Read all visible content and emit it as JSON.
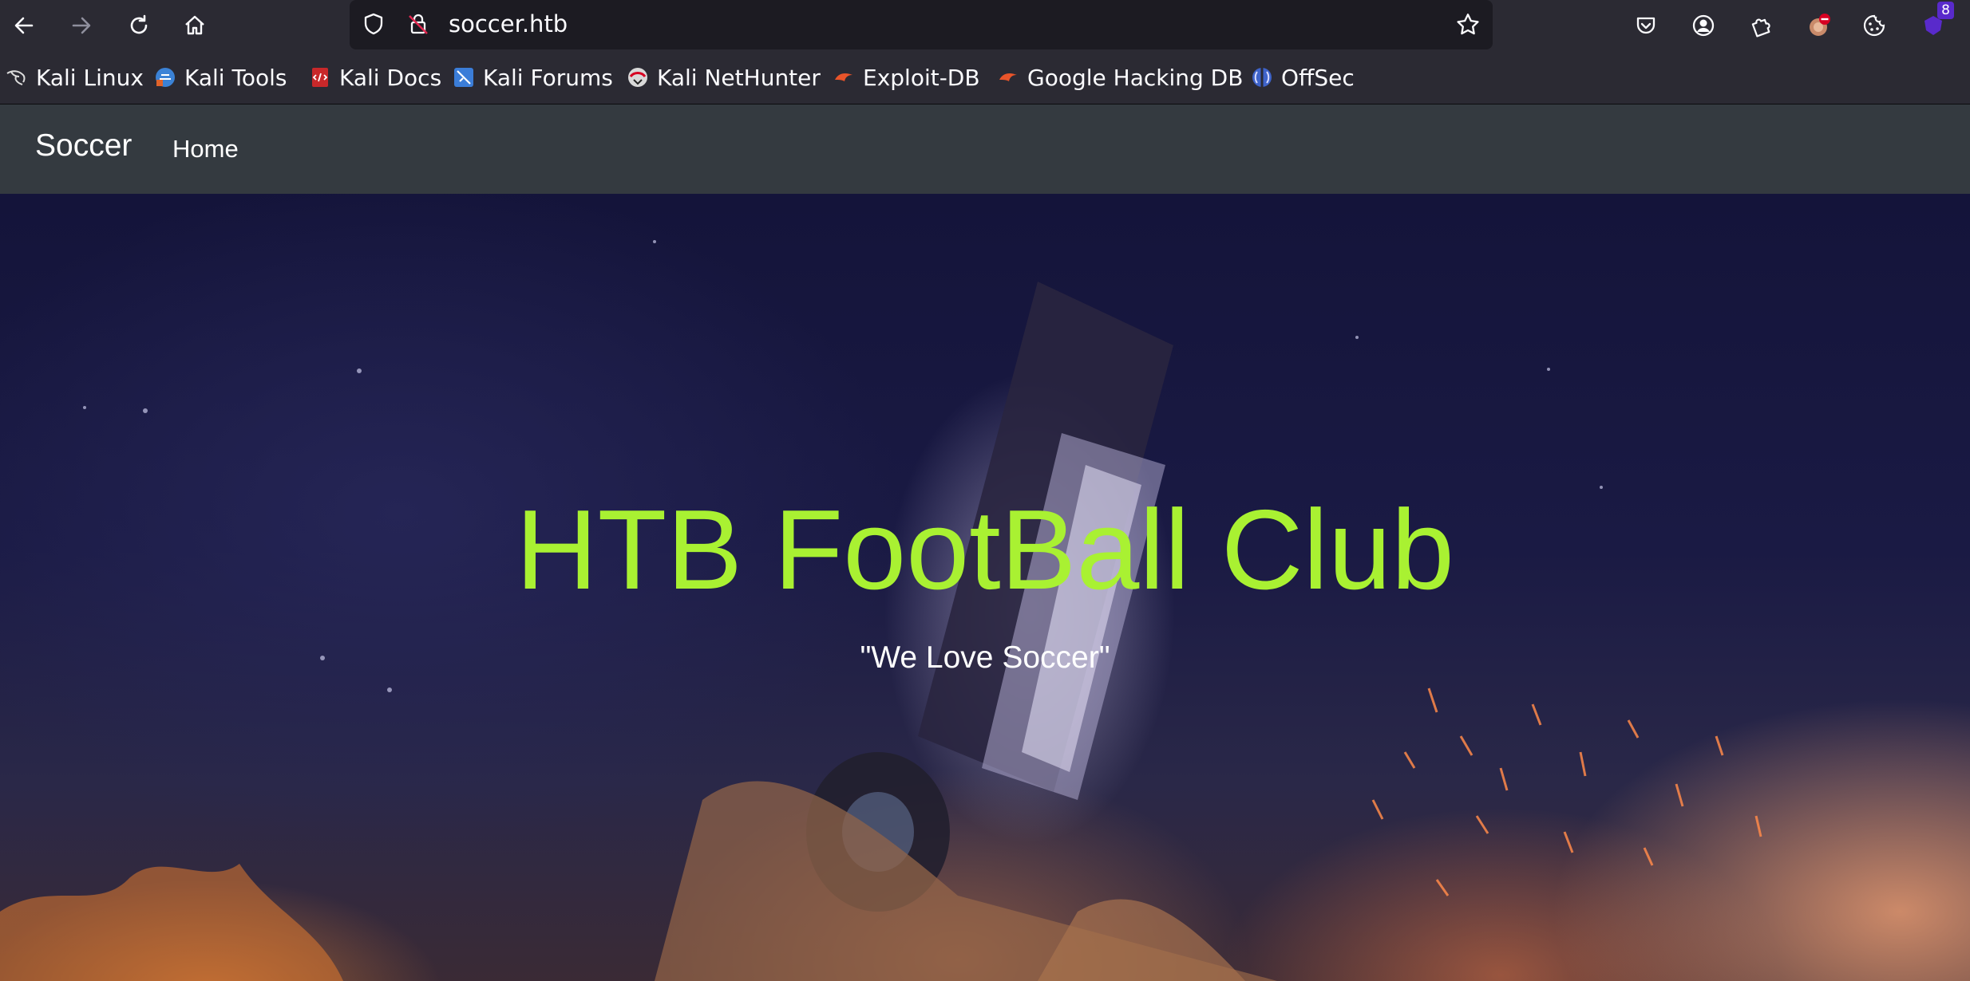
{
  "browser": {
    "url": "soccer.htb",
    "extension_badge_count": "8",
    "bookmarks": [
      {
        "label": "Kali Linux",
        "icon": "kali-dragon-icon"
      },
      {
        "label": "Kali Tools",
        "icon": "kali-tools-icon"
      },
      {
        "label": "Kali Docs",
        "icon": "kali-docs-icon"
      },
      {
        "label": "Kali Forums",
        "icon": "kali-forums-icon"
      },
      {
        "label": "Kali NetHunter",
        "icon": "kali-nethunter-icon"
      },
      {
        "label": "Exploit-DB",
        "icon": "exploit-db-icon"
      },
      {
        "label": "Google Hacking DB",
        "icon": "ghdb-icon"
      },
      {
        "label": "OffSec",
        "icon": "offsec-icon"
      }
    ]
  },
  "site": {
    "brand": "Soccer",
    "nav": {
      "home": "Home"
    },
    "hero": {
      "title": "HTB FootBall Club",
      "subtitle": "\"We Love Soccer\""
    }
  },
  "colors": {
    "title_accent": "#a9f132",
    "navbar_bg": "#343a40",
    "browser_chrome": "#2b2a33"
  }
}
